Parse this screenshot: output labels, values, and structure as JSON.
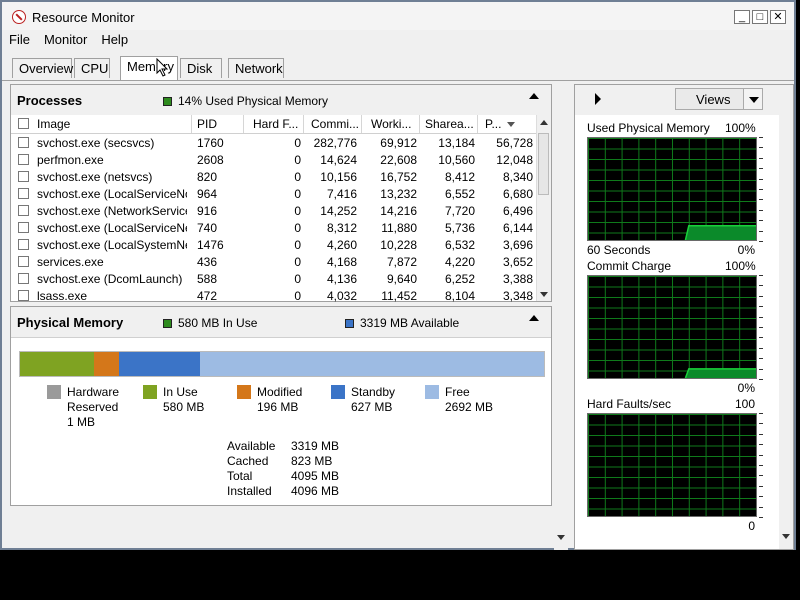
{
  "window": {
    "title": "Resource Monitor"
  },
  "menu": [
    "File",
    "Monitor",
    "Help"
  ],
  "tabs": [
    "Overview",
    "CPU",
    "Memory",
    "Disk",
    "Network"
  ],
  "processes": {
    "title": "Processes",
    "summary": "14% Used Physical Memory",
    "columns": [
      "Image",
      "PID",
      "Hard F...",
      "Commi...",
      "Worki...",
      "Sharea...",
      "P..."
    ],
    "rows": [
      [
        "svchost.exe (secsvcs)",
        "1760",
        "0",
        "282,776",
        "69,912",
        "13,184",
        "56,728"
      ],
      [
        "perfmon.exe",
        "2608",
        "0",
        "14,624",
        "22,608",
        "10,560",
        "12,048"
      ],
      [
        "svchost.exe (netsvcs)",
        "820",
        "0",
        "10,156",
        "16,752",
        "8,412",
        "8,340"
      ],
      [
        "svchost.exe (LocalServiceNo...",
        "964",
        "0",
        "7,416",
        "13,232",
        "6,552",
        "6,680"
      ],
      [
        "svchost.exe (NetworkService)",
        "916",
        "0",
        "14,252",
        "14,216",
        "7,720",
        "6,496"
      ],
      [
        "svchost.exe (LocalServiceNet...",
        "740",
        "0",
        "8,312",
        "11,880",
        "5,736",
        "6,144"
      ],
      [
        "svchost.exe (LocalSystemNet...",
        "1476",
        "0",
        "4,260",
        "10,228",
        "6,532",
        "3,696"
      ],
      [
        "services.exe",
        "436",
        "0",
        "4,168",
        "7,872",
        "4,220",
        "3,652"
      ],
      [
        "svchost.exe (DcomLaunch)",
        "588",
        "0",
        "4,136",
        "9,640",
        "6,252",
        "3,388"
      ],
      [
        "lsass.exe",
        "472",
        "0",
        "4,032",
        "11,452",
        "8,104",
        "3,348"
      ]
    ]
  },
  "physical_memory": {
    "title": "Physical Memory",
    "in_use_summary": "580 MB In Use",
    "available_summary": "3319 MB Available",
    "bar": [
      {
        "name": "Hardware Reserved",
        "mb": 1,
        "color": "#9a9a9a"
      },
      {
        "name": "In Use",
        "mb": 580,
        "color": "#7fa322"
      },
      {
        "name": "Modified",
        "mb": 196,
        "color": "#d4771a"
      },
      {
        "name": "Standby",
        "mb": 627,
        "color": "#3b74c7"
      },
      {
        "name": "Free",
        "mb": 2692,
        "color": "#9dbbe3"
      }
    ],
    "legend": [
      {
        "line1": "Hardware",
        "line2": "Reserved",
        "line3": "1 MB",
        "color": "#9a9a9a"
      },
      {
        "line1": "In Use",
        "line2": "580 MB",
        "color": "#7fa322"
      },
      {
        "line1": "Modified",
        "line2": "196 MB",
        "color": "#d4771a"
      },
      {
        "line1": "Standby",
        "line2": "627 MB",
        "color": "#3b74c7"
      },
      {
        "line1": "Free",
        "line2": "2692 MB",
        "color": "#9dbbe3"
      }
    ],
    "summary_rows": [
      {
        "label": "Available",
        "value": "3319 MB"
      },
      {
        "label": "Cached",
        "value": "823 MB"
      },
      {
        "label": "Total",
        "value": "4095 MB"
      },
      {
        "label": "Installed",
        "value": "4096 MB"
      }
    ]
  },
  "right_panel": {
    "views_label": "Views",
    "graphs": [
      {
        "title": "Used Physical Memory",
        "max": "100%",
        "bottom_left": "60 Seconds",
        "bottom_right": "0%",
        "level": 0.14
      },
      {
        "title": "Commit Charge",
        "max": "100%",
        "bottom_left": "",
        "bottom_right": "0%",
        "level": 0.09
      },
      {
        "title": "Hard Faults/sec",
        "max": "100",
        "bottom_left": "",
        "bottom_right": "0",
        "level": 0.0
      }
    ]
  },
  "colors": {
    "graph_line": "#19d13a",
    "graph_fill": "#0b8a2a",
    "in_use_square": "#2e8b1e",
    "available_square": "#3b74c7"
  }
}
